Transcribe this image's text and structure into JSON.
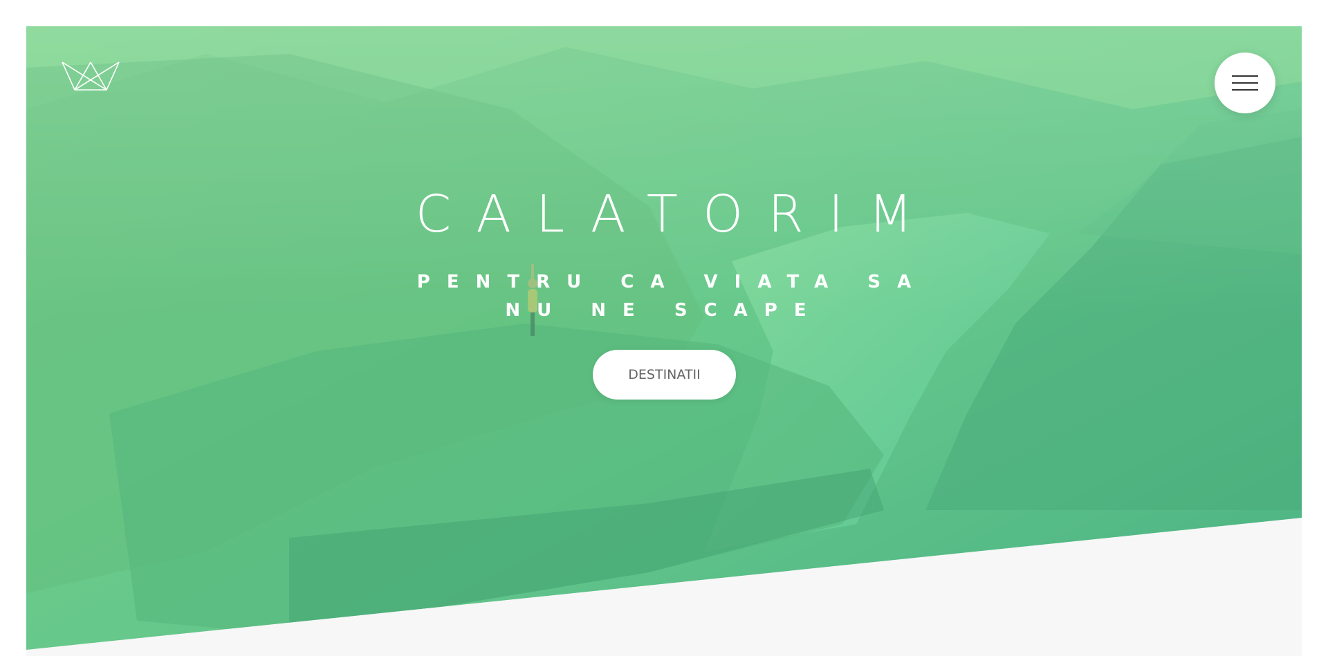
{
  "header": {
    "logo_icon": "crown-logo-icon",
    "menu_icon": "hamburger-menu-icon"
  },
  "hero": {
    "title": "CALATORIM",
    "subtitle": "PENTRU CA VIATA SA NU NE SCAPE",
    "cta_label": "DESTINATII"
  },
  "colors": {
    "overlay_light": "#86d98f",
    "overlay_dark": "#3ca87f",
    "page_background": "#f7f7f7",
    "button_text": "#666666"
  }
}
